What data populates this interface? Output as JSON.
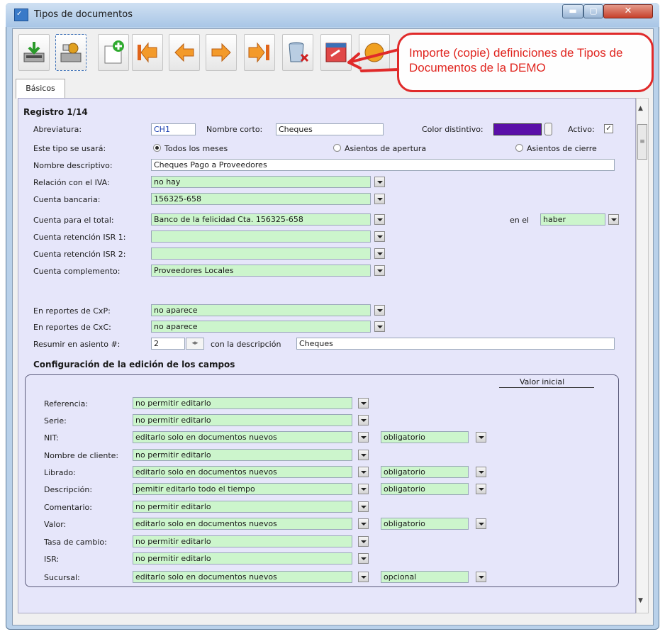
{
  "window": {
    "title": "Tipos de documentos",
    "icon": "app-icon"
  },
  "toolbar": [
    {
      "name": "import-icon"
    },
    {
      "name": "settings-icon"
    },
    {
      "name": "new-document-icon"
    },
    {
      "name": "first-record-icon"
    },
    {
      "name": "previous-record-icon"
    },
    {
      "name": "next-record-icon"
    },
    {
      "name": "last-record-icon"
    },
    {
      "name": "delete-icon"
    },
    {
      "name": "import-demo-icon"
    },
    {
      "name": "help-icon"
    }
  ],
  "callout": {
    "text": "Importe (copie)  definiciones de Tipos de Documentos de la DEMO",
    "color": "#e0251f"
  },
  "tab": {
    "label": "Básicos"
  },
  "record": {
    "label": "Registro 1/14"
  },
  "form": {
    "abreviatura": {
      "label": "Abreviatura:",
      "value": "CH1"
    },
    "nombre_corto": {
      "label": "Nombre corto:",
      "value": "Cheques"
    },
    "color_distintivo": {
      "label": "Color distintivo:",
      "color": "#5a0fa8"
    },
    "activo": {
      "label": "Activo:",
      "checked": true
    },
    "uso": {
      "label": "Este tipo se usará:",
      "options": [
        "Todos los meses",
        "Asientos de apertura",
        "Asientos de cierre"
      ],
      "selected": "Todos los meses"
    },
    "nombre_descriptivo": {
      "label": "Nombre descriptivo:",
      "value": "Cheques Pago a Proveedores"
    },
    "relacion_iva": {
      "label": "Relación con el IVA:",
      "value": "no hay"
    },
    "cuenta_bancaria": {
      "label": "Cuenta bancaria:",
      "value": "156325-658"
    },
    "cuenta_total": {
      "label": "Cuenta para el total:",
      "value": "Banco de la felicidad Cta. 156325-658"
    },
    "en_el": {
      "label": "en el",
      "value": "haber"
    },
    "isr1": {
      "label": "Cuenta retención ISR 1:",
      "value": ""
    },
    "isr2": {
      "label": "Cuenta retención ISR 2:",
      "value": ""
    },
    "complemento": {
      "label": "Cuenta complemento:",
      "value": "Proveedores Locales"
    },
    "reportes_cxp": {
      "label": "En reportes de CxP:",
      "value": "no aparece"
    },
    "reportes_cxc": {
      "label": "En reportes de CxC:",
      "value": "no aparece"
    },
    "resumir": {
      "label": "Resumir en asiento #:",
      "value": "2",
      "desc_label": "con la descripción",
      "desc_value": "Cheques"
    }
  },
  "config": {
    "title": "Configuración de la edición de los campos",
    "valor_inicial_header": "Valor inicial",
    "rows": [
      {
        "label": "Referencia:",
        "mode": "no permitir editarlo",
        "req": null
      },
      {
        "label": "Serie:",
        "mode": "no permitir editarlo",
        "req": null
      },
      {
        "label": "NIT:",
        "mode": "editarlo solo en documentos nuevos",
        "req": "obligatorio"
      },
      {
        "label": "Nombre de cliente:",
        "mode": "no permitir editarlo",
        "req": null
      },
      {
        "label": "Librado:",
        "mode": "editarlo solo en documentos nuevos",
        "req": "obligatorio"
      },
      {
        "label": "Descripción:",
        "mode": "pemitir editarlo todo el tiempo",
        "req": "obligatorio"
      },
      {
        "label": "Comentario:",
        "mode": "no permitir editarlo",
        "req": null
      },
      {
        "label": "Valor:",
        "mode": "editarlo solo en documentos nuevos",
        "req": "obligatorio"
      },
      {
        "label": "Tasa de cambio:",
        "mode": "no permitir editarlo",
        "req": null
      },
      {
        "label": "ISR:",
        "mode": "no permitir editarlo",
        "req": null
      },
      {
        "label": "Sucursal:",
        "mode": "editarlo solo en documentos nuevos",
        "req": "opcional"
      }
    ]
  },
  "colors": {
    "panel": "#e6e6fa",
    "select_bg": "#ccf5cc",
    "accent_red": "#e02a2a"
  }
}
